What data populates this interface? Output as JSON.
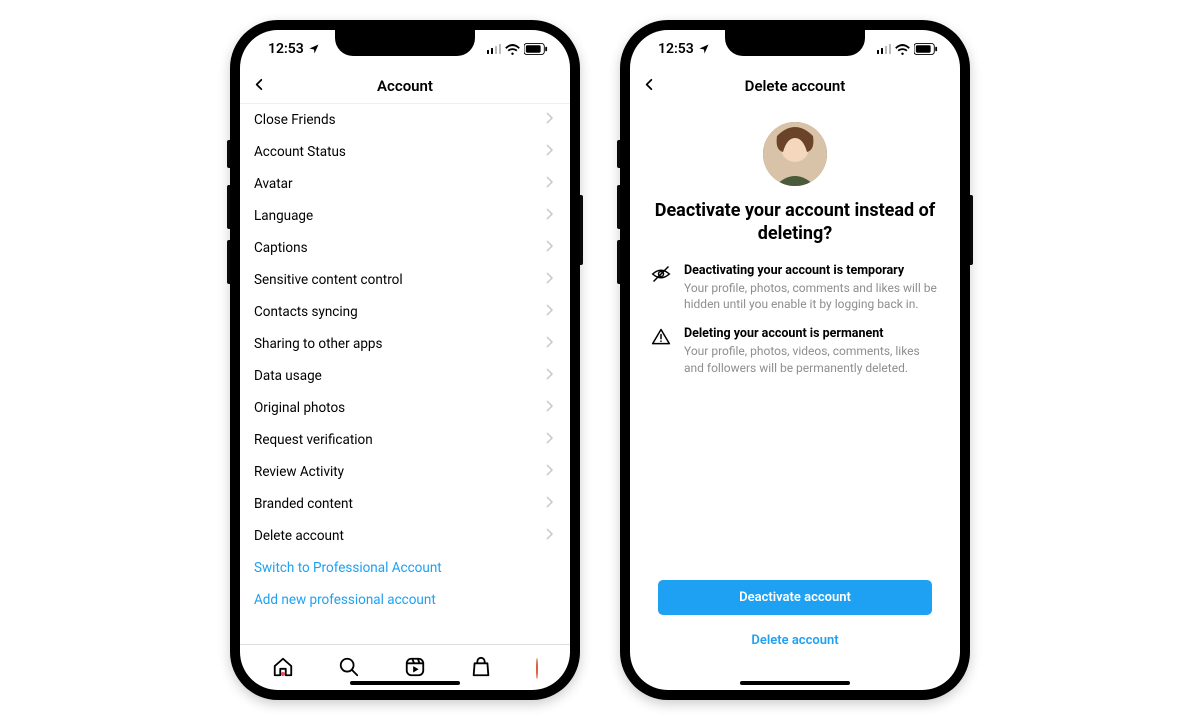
{
  "status": {
    "time": "12:53"
  },
  "left": {
    "title": "Account",
    "items": [
      "Close Friends",
      "Account Status",
      "Avatar",
      "Language",
      "Captions",
      "Sensitive content control",
      "Contacts syncing",
      "Sharing to other apps",
      "Data usage",
      "Original photos",
      "Request verification",
      "Review Activity",
      "Branded content",
      "Delete account"
    ],
    "links": [
      "Switch to Professional Account",
      "Add new professional account"
    ]
  },
  "right": {
    "title": "Delete account",
    "heading": "Deactivate your account instead of deleting?",
    "info": [
      {
        "heading": "Deactivating your account is temporary",
        "sub": "Your profile, photos, comments and likes will be hidden until you enable it by logging back in."
      },
      {
        "heading": "Deleting your account is permanent",
        "sub": "Your profile, photos, videos, comments, likes and followers will be permanently deleted."
      }
    ],
    "primary": "Deactivate account",
    "secondary": "Delete account"
  }
}
